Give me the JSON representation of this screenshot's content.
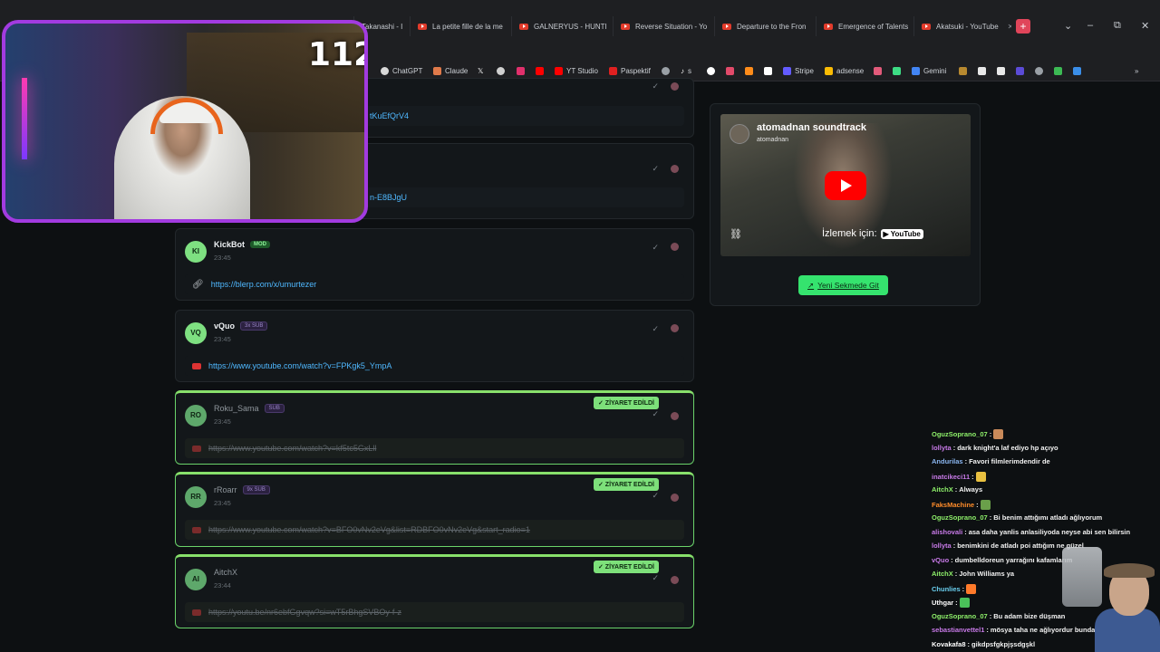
{
  "tabs": [
    {
      "label": "Takanashi - I"
    },
    {
      "label": "La petite fille de la me"
    },
    {
      "label": "GALNERYUS - HUNTI"
    },
    {
      "label": "Reverse Situation - Yo"
    },
    {
      "label": "Departure to the Fron"
    },
    {
      "label": "Emergence of Talents"
    },
    {
      "label": "Akatsuki - YouTube"
    }
  ],
  "new_tab": "+",
  "window_controls": {
    "dropdown": "⌄",
    "minimize": "–",
    "maximize": "⧉",
    "close": "✕"
  },
  "bookmarks": [
    {
      "label": "ChatGPT",
      "color": "#d9d9d9"
    },
    {
      "label": "Claude",
      "color": "#e07a4a"
    },
    {
      "label": "",
      "color": "#ffffff"
    },
    {
      "label": "",
      "color": "#d0d0d0"
    },
    {
      "label": "",
      "color": "#e1306c"
    },
    {
      "label": "",
      "color": "#ff0000"
    },
    {
      "label": "YT Studio",
      "color": "#ff0000"
    },
    {
      "label": "Paspektif",
      "color": "#e02020"
    },
    {
      "label": "",
      "color": "#9aa0a6"
    },
    {
      "label": "s",
      "color": "#ffffff"
    },
    {
      "label": "",
      "color": "#ffffff"
    },
    {
      "label": "",
      "color": "#e24a6a"
    },
    {
      "label": "",
      "color": "#ff8c1a"
    },
    {
      "label": "",
      "color": "#ffffff"
    },
    {
      "label": "Stripe",
      "color": "#635bff"
    },
    {
      "label": "adsense",
      "color": "#fbbc04"
    },
    {
      "label": "",
      "color": "#e25a7a"
    },
    {
      "label": "",
      "color": "#3ddc84"
    },
    {
      "label": "Gemini",
      "color": "#4285f4"
    }
  ],
  "cards": [
    {
      "initials": "KI",
      "username": "KickBot",
      "badge": "MOD",
      "badge_type": "mod",
      "time": "23:45",
      "url": "https://blerp.com/x/umurtezer",
      "link_icon": "chain-icon",
      "visited": false
    },
    {
      "initials": "VQ",
      "username": "vQuo",
      "badge": "3x SUB",
      "badge_type": "sub",
      "time": "23:45",
      "url": "https://www.youtube.com/watch?v=FPKgk5_YmpA",
      "link_icon": "youtube-icon",
      "visited": false
    },
    {
      "initials": "RO",
      "username": "Roku_Sama",
      "badge": "SUB",
      "badge_type": "sub",
      "time": "23:45",
      "url": "https://www.youtube.com/watch?v=kf5tc5GxLll",
      "link_icon": "youtube-icon",
      "visited": true
    },
    {
      "initials": "RR",
      "username": "rRoarr",
      "badge": "9x SUB",
      "badge_type": "sub",
      "time": "23:45",
      "url": "https://www.youtube.com/watch?v=BFO0vNv2eVg&list=RDBFO0vNv2eVg&start_radio=1",
      "link_icon": "youtube-icon",
      "visited": true
    },
    {
      "initials": "AI",
      "username": "AitchX",
      "badge": "",
      "badge_type": "",
      "time": "23:44",
      "url": "https://youtu.be/nr6ebfGgvqw?si=wT5rBhgSVBOy-f-z",
      "link_icon": "youtube-icon",
      "visited": true
    }
  ],
  "partial_links": {
    "top1": "tKuEfQrV4",
    "top2": "n-E8BJgU"
  },
  "visited_label": "✓ ZİYARET EDİLDİ",
  "video": {
    "title": "atomadnan soundtrack",
    "channel": "atomadnan",
    "watch_on": "İzlemek için:",
    "youtube": "▶ YouTube"
  },
  "open_button": "Yeni Sekmede Git",
  "webcam_counter": "112",
  "chat": [
    {
      "user": "OguzSoprano_07",
      "text": "",
      "color": "#8ef06a",
      "emote": "#c98a5a"
    },
    {
      "user": "lollyta",
      "text": "dark knight'a laf ediyo hp açıyo",
      "color": "#c87ae8"
    },
    {
      "user": "Andurilas",
      "text": "Favori filmlerimdendir de",
      "color": "#8ab6f0"
    },
    {
      "user": "inatcikeci11",
      "text": "",
      "color": "#c87ae8",
      "emote": "#e8c040"
    },
    {
      "user": "AitchX",
      "text": "Always",
      "color": "#8ef06a"
    },
    {
      "user": "FaksMachine",
      "text": "",
      "color": "#ff8c2a",
      "emote": "#6aa04a"
    },
    {
      "user": "OguzSoprano_07",
      "text": "Bi benim attığımı atladı ağlıyorum",
      "color": "#8ef06a"
    },
    {
      "user": "alishovali",
      "text": "asa daha yanlis anlasiliyoda neyse abi sen bilirsin",
      "color": "#c87ae8"
    },
    {
      "user": "lollyta",
      "text": "benimkini de atladı poi attığım ne güzel",
      "color": "#c87ae8"
    },
    {
      "user": "vQuo",
      "text": "dumbelldoreun yarrağını kafamlarım",
      "color": "#c87ae8"
    },
    {
      "user": "AitchX",
      "text": "John Williams ya",
      "color": "#8ef06a"
    },
    {
      "user": "Chunlies",
      "text": "",
      "color": "#6ad0f0",
      "emote": "#ff7a2a"
    },
    {
      "user": "Uthgar",
      "text": "",
      "color": "#ffffff",
      "emote": "#4ac05a"
    },
    {
      "user": "OguzSoprano_07",
      "text": "Bu adam bize düşman",
      "color": "#8ef06a"
    },
    {
      "user": "sebastianvettel1",
      "text": "mösya taha ne ağlıyordur bunda",
      "color": "#c87ae8"
    },
    {
      "user": "Kovakafa8",
      "text": "gikdpsfgkpjşsdgşkl",
      "color": "#ffffff"
    }
  ]
}
